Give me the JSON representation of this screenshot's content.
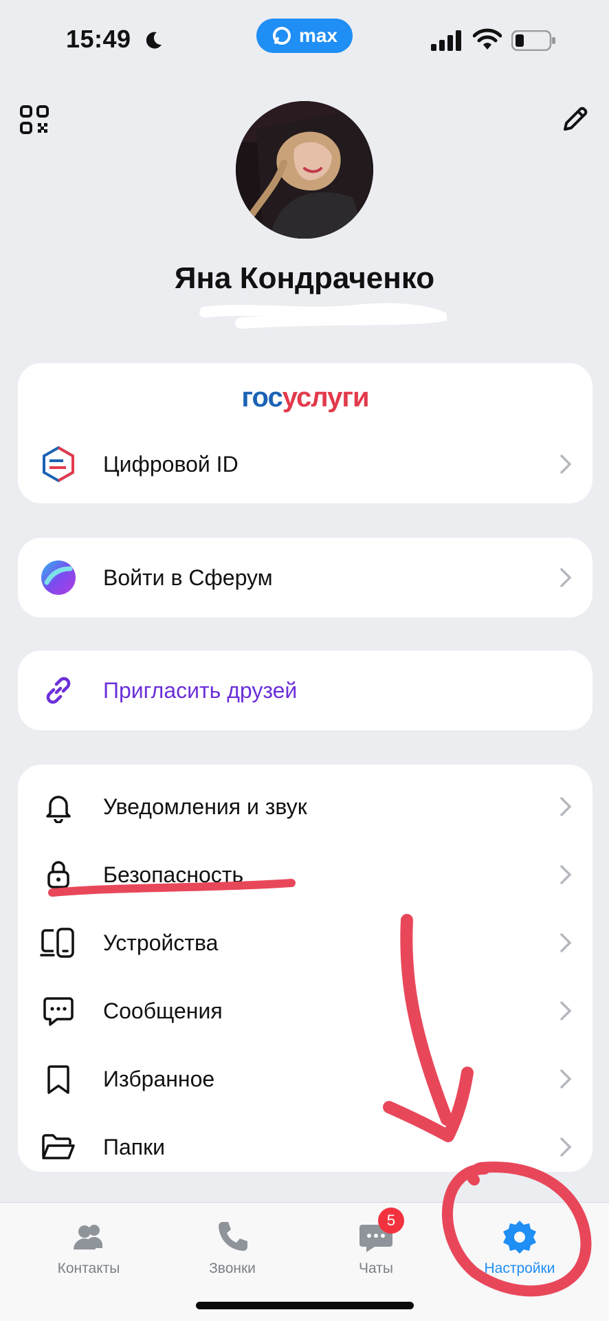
{
  "status_bar": {
    "time": "15:49",
    "app_pill": "max"
  },
  "profile": {
    "name": "Яна Кондраченко"
  },
  "gosuslugi": {
    "logo_part1": "гос",
    "logo_part2": "услуги",
    "item_label": "Цифровой ID"
  },
  "sferum": {
    "label": "Войти в Сферум"
  },
  "invite": {
    "label": "Пригласить друзей",
    "color": "#6b2fd9"
  },
  "settings_list": [
    {
      "label": "Уведомления и звук",
      "icon": "bell-icon"
    },
    {
      "label": "Безопасность",
      "icon": "lock-icon"
    },
    {
      "label": "Устройства",
      "icon": "devices-icon"
    },
    {
      "label": "Сообщения",
      "icon": "message-icon"
    },
    {
      "label": "Избранное",
      "icon": "bookmark-icon"
    },
    {
      "label": "Папки",
      "icon": "folder-icon"
    }
  ],
  "tabbar": {
    "tabs": [
      {
        "label": "Контакты",
        "icon": "contacts-icon"
      },
      {
        "label": "Звонки",
        "icon": "phone-icon"
      },
      {
        "label": "Чаты",
        "icon": "chat-icon"
      },
      {
        "label": "Настройки",
        "icon": "gear-icon",
        "active": true
      }
    ],
    "chats_badge": "5"
  },
  "colors": {
    "accent": "#1f8ef5",
    "annotation_red": "#e8475a",
    "background": "#ebedf1"
  }
}
